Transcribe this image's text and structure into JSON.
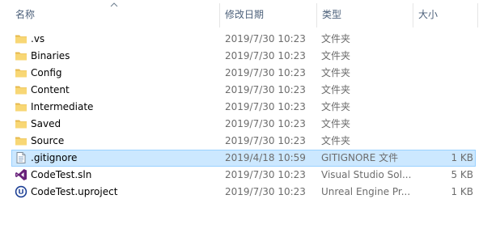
{
  "columns": {
    "name": "名称",
    "date": "修改日期",
    "type": "类型",
    "size": "大小"
  },
  "sort": {
    "column": "name",
    "direction": "ascending"
  },
  "colors": {
    "folder": "#f8d775",
    "selection_bg": "#cce8ff",
    "selection_border": "#99d1ff",
    "header_text": "#4c607a",
    "vs_purple": "#68217a",
    "unreal_blue": "#1c3f94"
  },
  "files": [
    {
      "name": ".vs",
      "date": "2019/7/30 10:23",
      "type": "文件夹",
      "size": "",
      "icon": "folder-icon",
      "selected": false
    },
    {
      "name": "Binaries",
      "date": "2019/7/30 10:23",
      "type": "文件夹",
      "size": "",
      "icon": "folder-icon",
      "selected": false
    },
    {
      "name": "Config",
      "date": "2019/7/30 10:23",
      "type": "文件夹",
      "size": "",
      "icon": "folder-icon",
      "selected": false
    },
    {
      "name": "Content",
      "date": "2019/7/30 10:23",
      "type": "文件夹",
      "size": "",
      "icon": "folder-icon",
      "selected": false
    },
    {
      "name": "Intermediate",
      "date": "2019/7/30 10:23",
      "type": "文件夹",
      "size": "",
      "icon": "folder-icon",
      "selected": false
    },
    {
      "name": "Saved",
      "date": "2019/7/30 10:23",
      "type": "文件夹",
      "size": "",
      "icon": "folder-icon",
      "selected": false
    },
    {
      "name": "Source",
      "date": "2019/7/30 10:23",
      "type": "文件夹",
      "size": "",
      "icon": "folder-icon",
      "selected": false
    },
    {
      "name": ".gitignore",
      "date": "2019/4/18 10:59",
      "type": "GITIGNORE 文件",
      "size": "1 KB",
      "icon": "text-file-icon",
      "selected": true
    },
    {
      "name": "CodeTest.sln",
      "date": "2019/7/30 10:23",
      "type": "Visual Studio Sol...",
      "size": "5 KB",
      "icon": "visual-studio-icon",
      "selected": false
    },
    {
      "name": "CodeTest.uproject",
      "date": "2019/7/30 10:23",
      "type": "Unreal Engine Pr...",
      "size": "1 KB",
      "icon": "unreal-engine-icon",
      "selected": false
    }
  ]
}
